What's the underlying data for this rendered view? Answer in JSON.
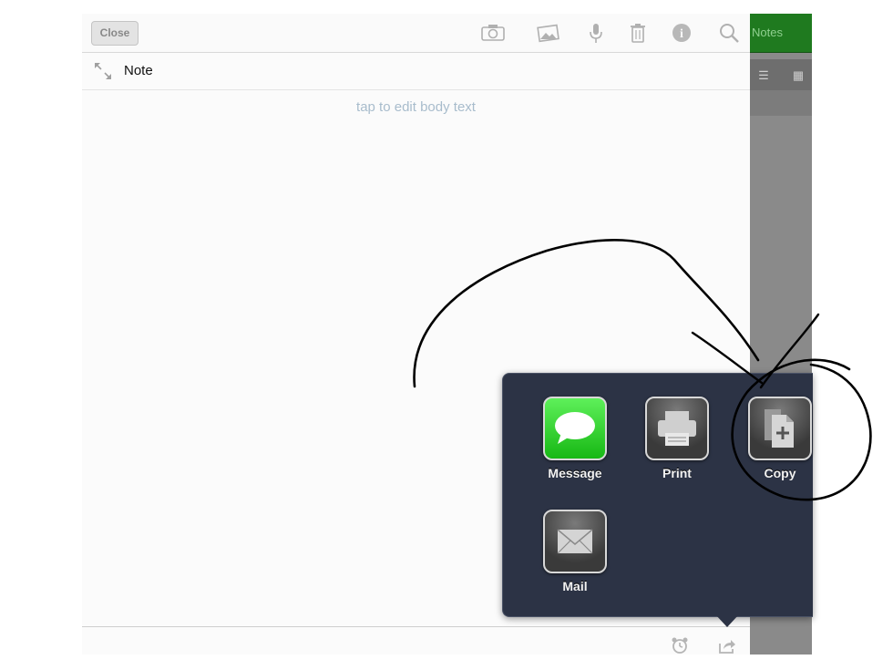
{
  "toolbar": {
    "close_label": "Close",
    "icons": [
      "camera-icon",
      "photo-icon",
      "microphone-icon",
      "trash-icon",
      "info-icon",
      "search-icon"
    ]
  },
  "note": {
    "title": "Note",
    "body_placeholder": "tap to edit body text"
  },
  "side_panel": {
    "title_fragment": "Notes"
  },
  "share_menu": {
    "items": [
      {
        "label": "Message",
        "icon": "message-bubble-icon"
      },
      {
        "label": "Print",
        "icon": "printer-icon"
      },
      {
        "label": "Copy",
        "icon": "copy-document-icon"
      },
      {
        "label": "Mail",
        "icon": "mail-envelope-icon"
      }
    ]
  },
  "bottom_toolbar": {
    "icons": [
      "alarm-clock-icon",
      "share-icon"
    ]
  },
  "colors": {
    "popover_bg": "#2c3345",
    "accent_green": "#1f7a1f",
    "placeholder_text": "#a8bccc"
  }
}
